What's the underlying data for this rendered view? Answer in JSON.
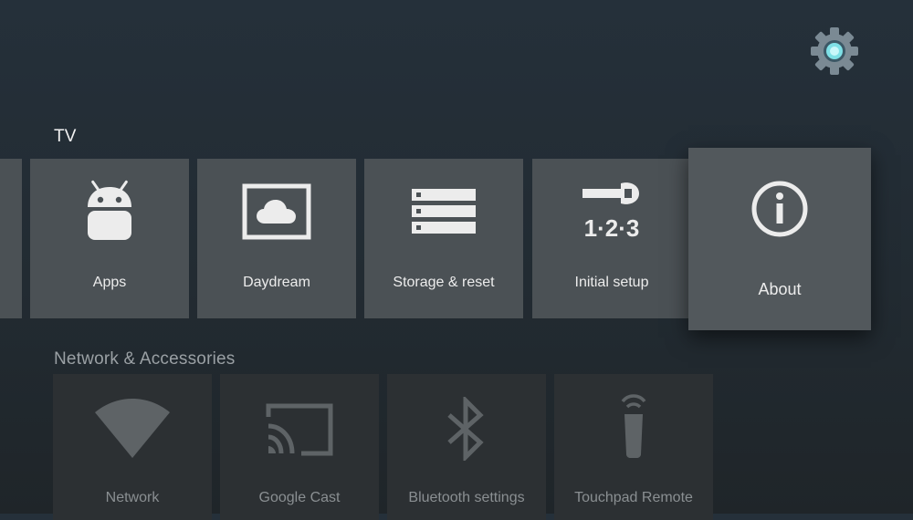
{
  "header": {
    "settings_icon": "gear-icon",
    "accent": "#7fe0e6"
  },
  "sections": {
    "tv": {
      "title": "TV",
      "items": [
        {
          "label": "Apps",
          "icon": "android-icon"
        },
        {
          "label": "Daydream",
          "icon": "daydream-icon"
        },
        {
          "label": "Storage & reset",
          "icon": "storage-icon"
        },
        {
          "label": "Initial setup",
          "icon": "setup-wrench-icon"
        },
        {
          "label": "About",
          "icon": "info-icon"
        }
      ]
    },
    "network": {
      "title": "Network & Accessories",
      "items": [
        {
          "label": "Network",
          "icon": "wifi-icon"
        },
        {
          "label": "Google Cast",
          "icon": "cast-icon"
        },
        {
          "label": "Bluetooth settings",
          "icon": "bluetooth-icon"
        },
        {
          "label": "Touchpad Remote",
          "icon": "remote-icon"
        }
      ]
    }
  },
  "colors": {
    "card": "#4b5155",
    "card_focused": "#52585c",
    "card_dim": "#2c3033",
    "icon": "#ececec",
    "icon_dim": "#5e6366"
  }
}
